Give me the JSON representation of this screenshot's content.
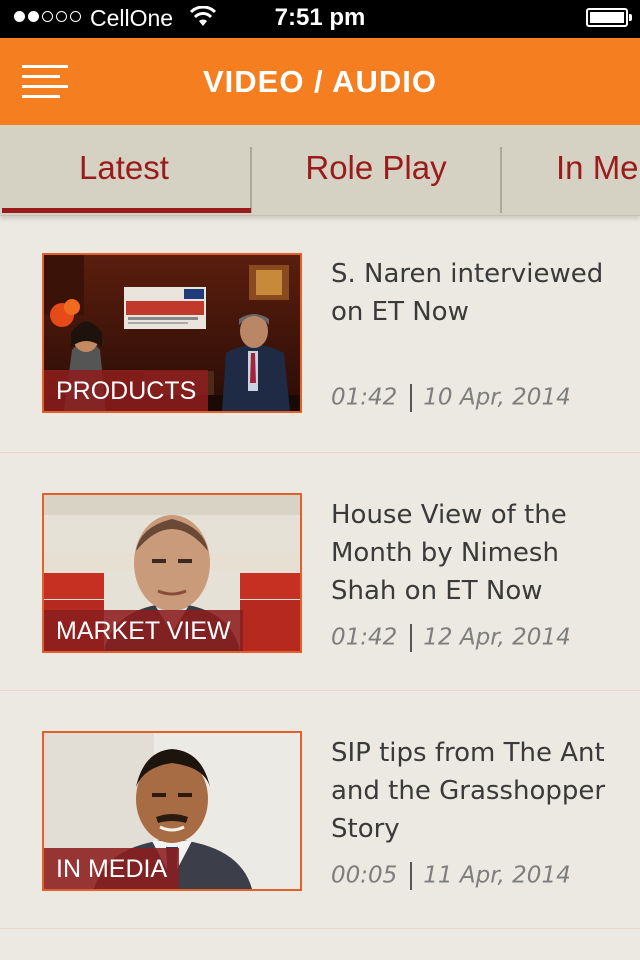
{
  "status_bar": {
    "carrier": "CellOne",
    "time": "7:51 pm",
    "signal_bars_filled": 2,
    "signal_bars_total": 5
  },
  "header": {
    "title": "VIDEO / AUDIO",
    "menu_icon": "hamburger-menu-icon",
    "background_color": "#f47e20"
  },
  "tabs": [
    {
      "label": "Latest",
      "active": true
    },
    {
      "label": "Role Play",
      "active": false
    },
    {
      "label": "In Me",
      "active": false
    }
  ],
  "videos": [
    {
      "category": "PRODUCTS",
      "title": "S. Naren interviewed on ET Now",
      "duration": "01:42",
      "date": "10 Apr, 2014"
    },
    {
      "category": "MARKET VIEW",
      "title": "House View of the Month by Nimesh Shah on ET Now",
      "duration": "01:42",
      "date": "12 Apr, 2014"
    },
    {
      "category": "IN MEDIA",
      "title": "SIP tips from The Ant and the Grasshopper Story",
      "duration": "00:05",
      "date": "11 Apr, 2014"
    }
  ],
  "colors": {
    "accent": "#f47e20",
    "tab_text": "#9a1b1b",
    "background": "#ebe9e1"
  }
}
